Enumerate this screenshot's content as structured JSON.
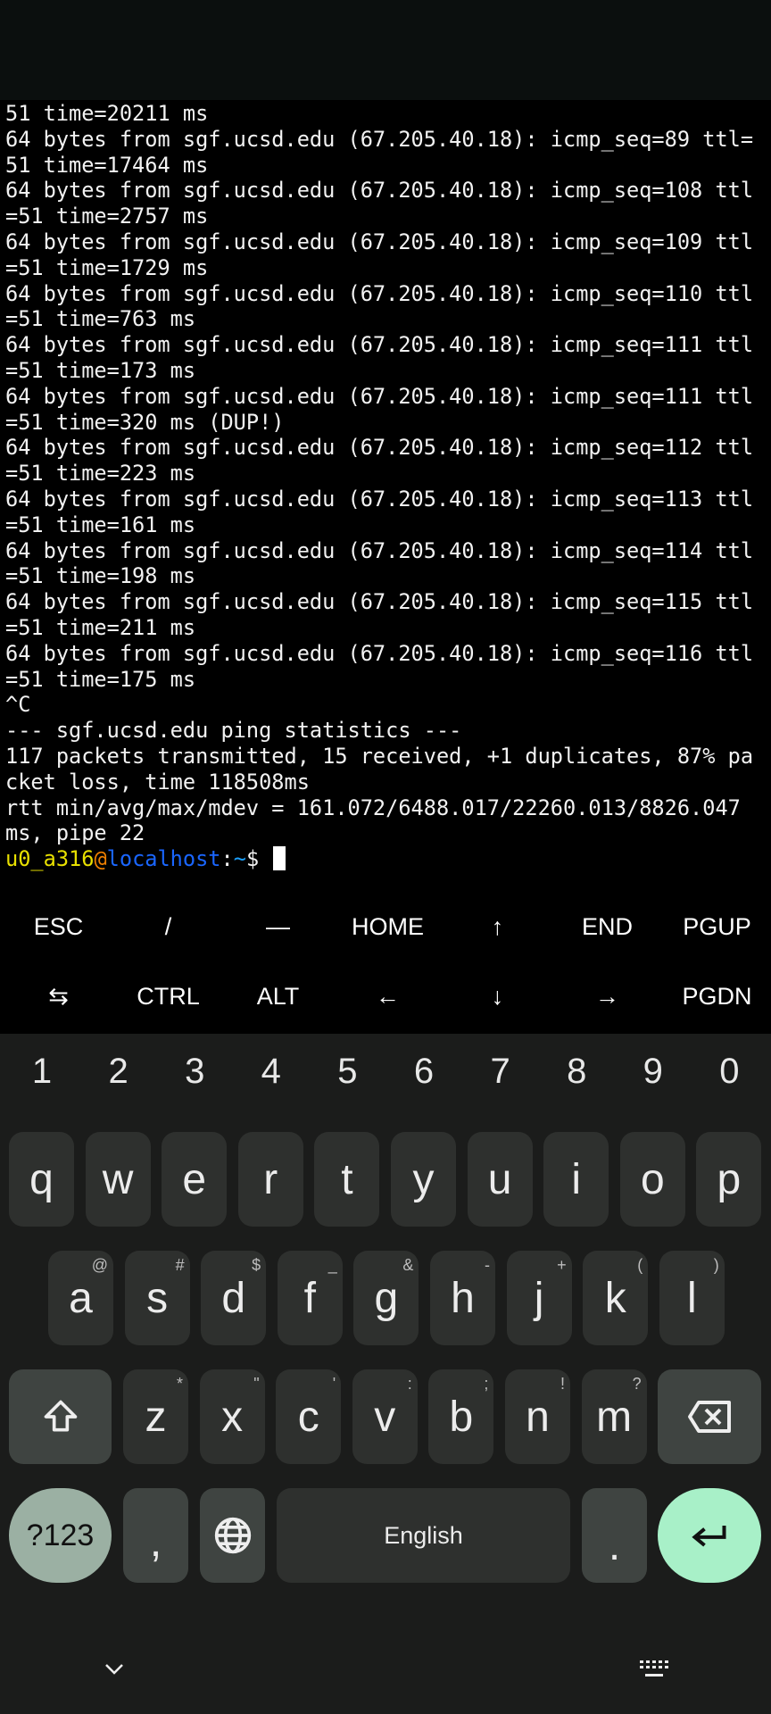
{
  "terminal": {
    "lines": [
      "51 time=20211 ms",
      "64 bytes from sgf.ucsd.edu (67.205.40.18): icmp_seq=89 ttl=",
      "51 time=17464 ms",
      "64 bytes from sgf.ucsd.edu (67.205.40.18): icmp_seq=108 ttl",
      "=51 time=2757 ms",
      "64 bytes from sgf.ucsd.edu (67.205.40.18): icmp_seq=109 ttl",
      "=51 time=1729 ms",
      "64 bytes from sgf.ucsd.edu (67.205.40.18): icmp_seq=110 ttl",
      "=51 time=763 ms",
      "64 bytes from sgf.ucsd.edu (67.205.40.18): icmp_seq=111 ttl",
      "=51 time=173 ms",
      "64 bytes from sgf.ucsd.edu (67.205.40.18): icmp_seq=111 ttl",
      "=51 time=320 ms (DUP!)",
      "64 bytes from sgf.ucsd.edu (67.205.40.18): icmp_seq=112 ttl",
      "=51 time=223 ms",
      "64 bytes from sgf.ucsd.edu (67.205.40.18): icmp_seq=113 ttl",
      "=51 time=161 ms",
      "64 bytes from sgf.ucsd.edu (67.205.40.18): icmp_seq=114 ttl",
      "=51 time=198 ms",
      "64 bytes from sgf.ucsd.edu (67.205.40.18): icmp_seq=115 ttl",
      "=51 time=211 ms",
      "64 bytes from sgf.ucsd.edu (67.205.40.18): icmp_seq=116 ttl",
      "=51 time=175 ms",
      "^C",
      "--- sgf.ucsd.edu ping statistics ---",
      "117 packets transmitted, 15 received, +1 duplicates, 87% pa",
      "cket loss, time 118508ms",
      "rtt min/avg/max/mdev = 161.072/6488.017/22260.013/8826.047",
      "ms, pipe 22"
    ],
    "prompt": {
      "user": "u0_a316",
      "at": "@",
      "host": "localhost",
      "sep": ":",
      "path": "~",
      "symbol": "$ "
    }
  },
  "extra_keys": [
    [
      "ESC",
      "/",
      "—",
      "HOME",
      "↑",
      "END",
      "PGUP"
    ],
    [
      "⇆",
      "CTRL",
      "ALT",
      "←",
      "↓",
      "→",
      "PGDN"
    ]
  ],
  "keyboard": {
    "numbers": [
      "1",
      "2",
      "3",
      "4",
      "5",
      "6",
      "7",
      "8",
      "9",
      "0"
    ],
    "row1": [
      "q",
      "w",
      "e",
      "r",
      "t",
      "y",
      "u",
      "i",
      "o",
      "p"
    ],
    "row2": [
      [
        "a",
        "@"
      ],
      [
        "s",
        "#"
      ],
      [
        "d",
        "$"
      ],
      [
        "f",
        "_"
      ],
      [
        "g",
        "&"
      ],
      [
        "h",
        "-"
      ],
      [
        "j",
        "+"
      ],
      [
        "k",
        "("
      ],
      [
        "l",
        ")"
      ]
    ],
    "row3": [
      [
        "z",
        "*"
      ],
      [
        "x",
        "\""
      ],
      [
        "c",
        "'"
      ],
      [
        "v",
        ":"
      ],
      [
        "b",
        ";"
      ],
      [
        "n",
        "!"
      ],
      [
        "m",
        "?"
      ]
    ],
    "symbols_label": "?123",
    "comma": ",",
    "space_label": "English",
    "period": ".",
    "colors": {
      "background": "#1b1c1b",
      "key": "#2e302e",
      "mod_key": "#3f4441",
      "symbols_key": "#9bb0a3",
      "enter_key": "#a8f0c8"
    }
  }
}
